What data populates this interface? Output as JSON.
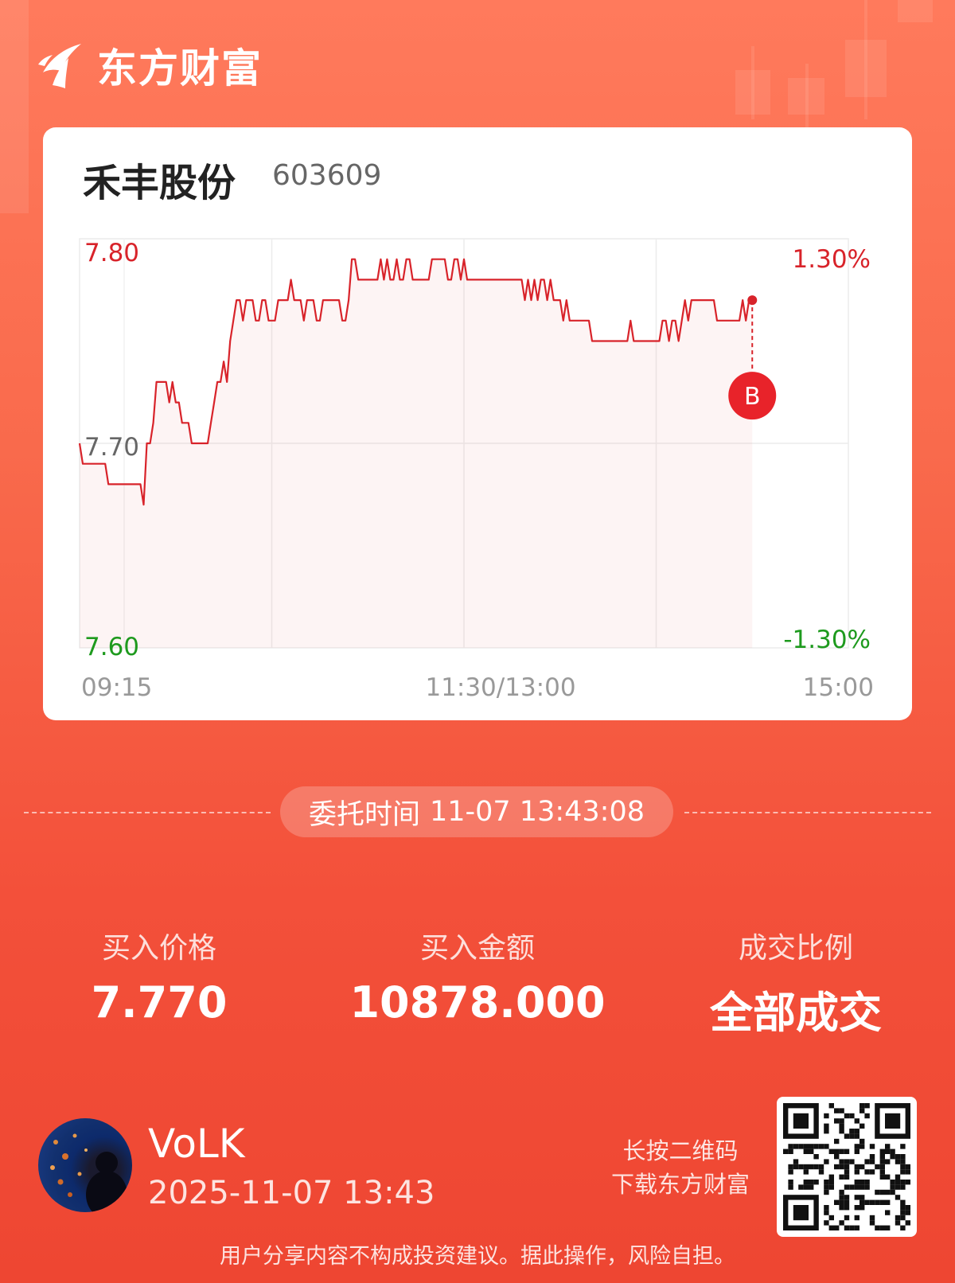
{
  "brand": {
    "name": "东方财富",
    "logo_icon": "eastmoney-logo-icon"
  },
  "stock": {
    "name": "禾丰股份",
    "code": "603609"
  },
  "chart_data": {
    "type": "line",
    "y_left_ticks": [
      "7.80",
      "7.70",
      "7.60"
    ],
    "y_right_ticks": [
      "1.30%",
      "-1.30%"
    ],
    "x_ticks": [
      "09:15",
      "11:30/13:00",
      "15:00"
    ],
    "ylim": [
      7.6,
      7.8
    ],
    "grid": true,
    "colors": {
      "up": "#d8232a",
      "down": "#1e9a1e",
      "neutral": "#666666",
      "line": "#d8232a"
    },
    "series": [
      {
        "values": [
          7.7,
          7.69,
          7.69,
          7.69,
          7.69,
          7.69,
          7.69,
          7.69,
          7.69,
          7.68,
          7.68,
          7.68,
          7.68,
          7.68,
          7.68,
          7.68,
          7.68,
          7.68,
          7.68,
          7.68,
          7.67,
          7.7,
          7.7,
          7.71,
          7.73,
          7.73,
          7.73,
          7.73,
          7.72,
          7.73,
          7.72,
          7.72,
          7.71,
          7.71,
          7.71,
          7.7,
          7.7,
          7.7,
          7.7,
          7.7,
          7.7,
          7.71,
          7.72,
          7.73,
          7.73,
          7.74,
          7.73,
          7.75,
          7.76,
          7.77,
          7.77,
          7.76,
          7.77,
          7.77,
          7.77,
          7.76,
          7.76,
          7.77,
          7.77,
          7.76,
          7.76,
          7.76,
          7.77,
          7.77,
          7.77,
          7.77,
          7.78,
          7.77,
          7.77,
          7.77,
          7.76,
          7.77,
          7.77,
          7.77,
          7.76,
          7.76,
          7.77,
          7.77,
          7.77,
          7.77,
          7.77,
          7.77,
          7.76,
          7.76,
          7.77,
          7.79,
          7.79,
          7.78,
          7.78,
          7.78,
          7.78,
          7.78,
          7.78,
          7.78,
          7.79,
          7.78,
          7.79,
          7.78,
          7.78,
          7.79,
          7.78,
          7.78,
          7.79,
          7.79,
          7.78,
          7.78,
          7.78,
          7.78,
          7.78,
          7.78,
          7.79,
          7.79,
          7.79,
          7.79,
          7.79,
          7.78,
          7.78,
          7.79,
          7.79,
          7.78,
          7.79,
          7.78,
          7.78,
          7.78,
          7.78,
          7.78,
          7.78,
          7.78,
          7.78,
          7.78,
          7.78,
          7.78,
          7.78,
          7.78,
          7.78,
          7.78,
          7.78,
          7.78,
          7.78,
          7.77,
          7.78,
          7.77,
          7.78,
          7.77,
          7.78,
          7.78,
          7.77,
          7.78,
          7.77,
          7.77,
          7.77,
          7.76,
          7.77,
          7.76,
          7.76,
          7.76,
          7.76,
          7.76,
          7.76,
          7.76,
          7.75,
          7.75,
          7.75,
          7.75,
          7.75,
          7.75,
          7.75,
          7.75,
          7.75,
          7.75,
          7.75,
          7.75,
          7.76,
          7.75,
          7.75,
          7.75,
          7.75,
          7.75,
          7.75,
          7.75,
          7.75,
          7.75,
          7.76,
          7.76,
          7.75,
          7.76,
          7.76,
          7.75,
          7.76,
          7.77,
          7.76,
          7.77,
          7.77,
          7.77,
          7.77,
          7.77,
          7.77,
          7.77,
          7.77,
          7.76,
          7.76,
          7.76,
          7.76,
          7.76,
          7.76,
          7.76,
          7.76,
          7.77,
          7.76,
          7.77,
          7.77
        ]
      }
    ],
    "marker": {
      "label": "B",
      "value": 7.77,
      "time": "13:43"
    }
  },
  "order": {
    "label": "委托时间",
    "time": "11-07 13:43:08"
  },
  "stats": [
    {
      "label": "买入价格",
      "value": "7.770"
    },
    {
      "label": "买入金额",
      "value": "10878.000"
    },
    {
      "label": "成交比例",
      "value": "全部成交"
    }
  ],
  "user": {
    "name": "VoLK",
    "time": "2025-11-07 13:43",
    "avatar_icon": "avatar-image"
  },
  "qr": {
    "hint_line1": "长按二维码",
    "hint_line2": "下载东方财富",
    "icon": "qr-code-icon"
  },
  "disclaimer": "用户分享内容不构成投资建议。据此操作，风险自担。"
}
